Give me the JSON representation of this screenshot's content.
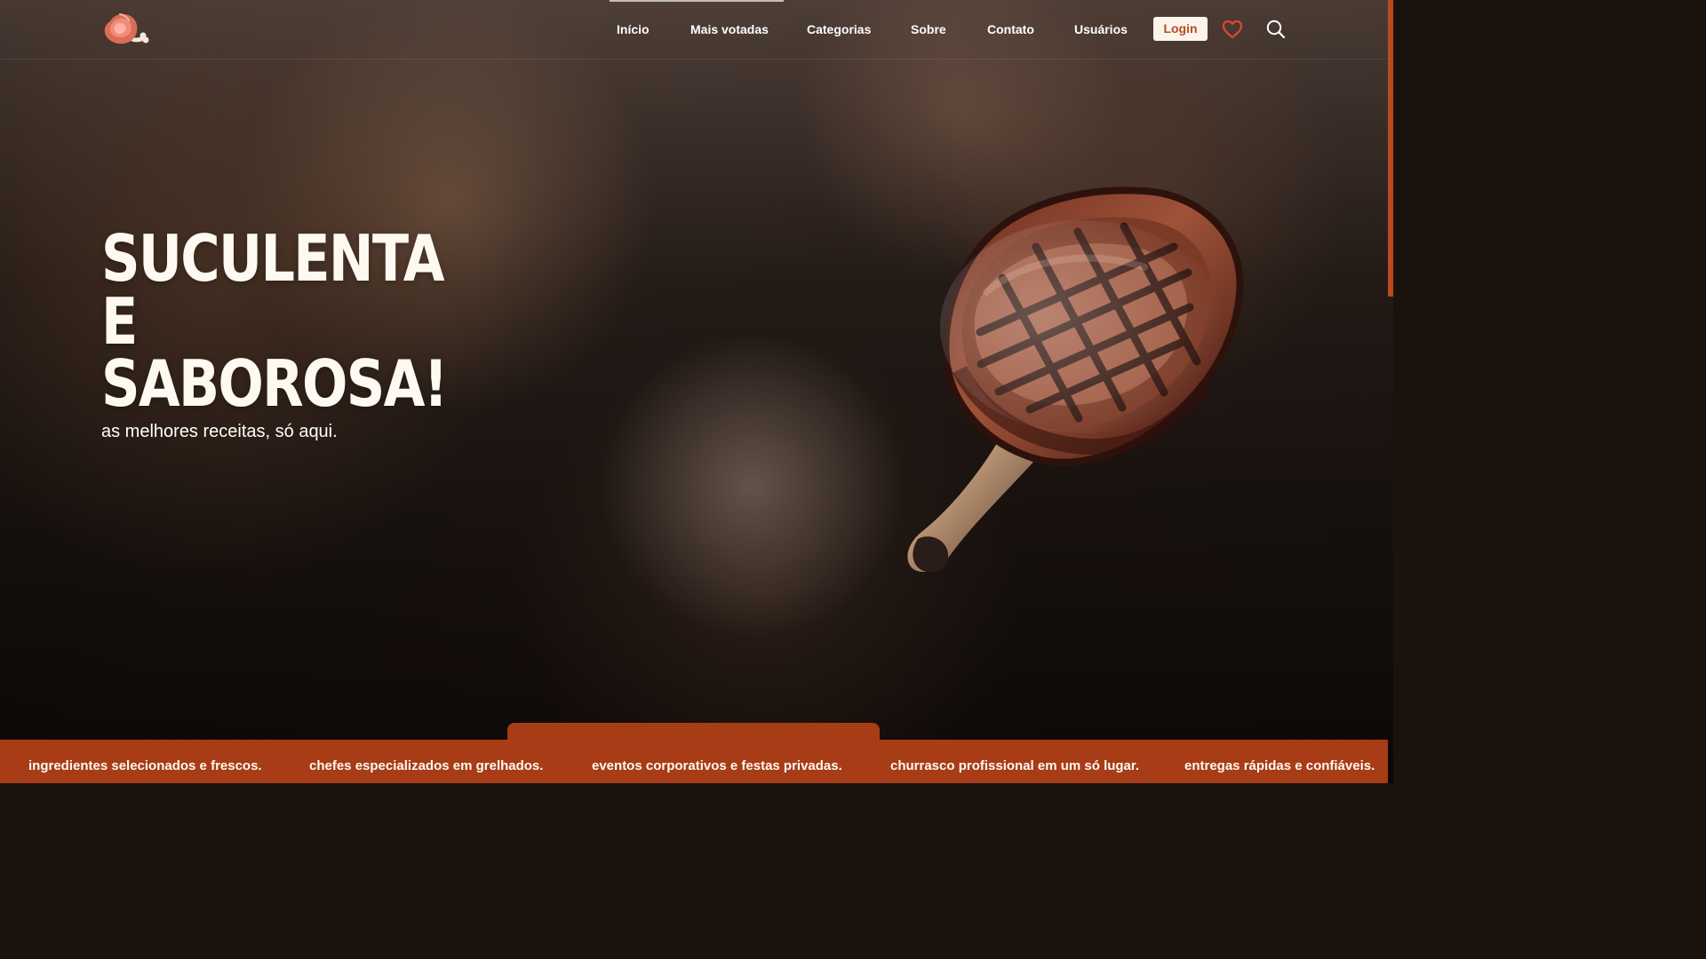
{
  "header": {
    "logo_icon": "ham-leg-icon",
    "nav_items": [
      {
        "label": "Início"
      },
      {
        "label": "Mais votadas"
      },
      {
        "label": "Categorias"
      },
      {
        "label": "Sobre"
      },
      {
        "label": "Contato"
      },
      {
        "label": "Usuários"
      }
    ],
    "login_label": "Login",
    "favorites_icon": "heart-icon",
    "search_icon": "search-icon"
  },
  "hero": {
    "title_line_1": "SUCULENTA E",
    "title_line_2": "SABOROSA!",
    "subtitle": "as melhores receitas, só aqui.",
    "image_icon": "steak-image"
  },
  "features": [
    {
      "label": "ingredientes selecionados e frescos."
    },
    {
      "label": "chefes especializados em grelhados."
    },
    {
      "label": "eventos corporativos e festas privadas."
    },
    {
      "label": "churrasco profissional em um só lugar."
    },
    {
      "label": "entregas rápidas e confiáveis."
    }
  ],
  "colors": {
    "accent": "#a73c17",
    "login_background": "#fbf4ea",
    "login_text": "#b24f24",
    "heart": "#e1462c"
  }
}
